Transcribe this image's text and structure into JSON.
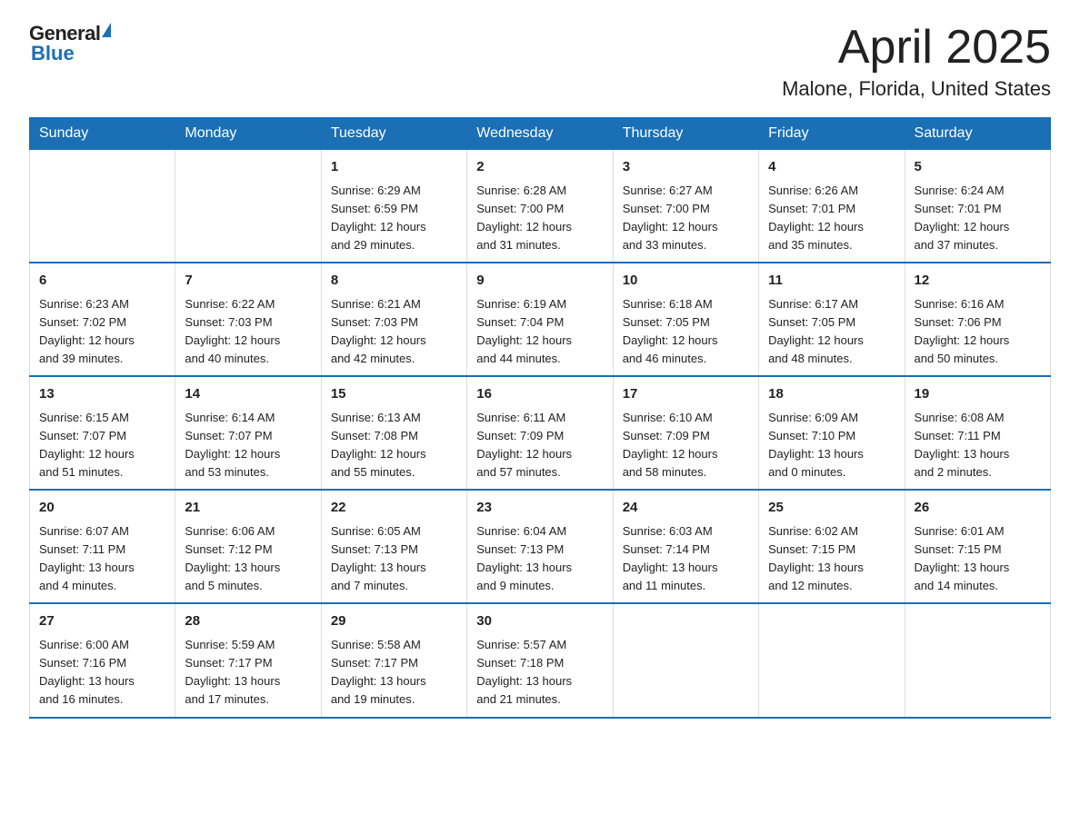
{
  "logo": {
    "text1": "General",
    "text2": "Blue"
  },
  "title": "April 2025",
  "subtitle": "Malone, Florida, United States",
  "days_of_week": [
    "Sunday",
    "Monday",
    "Tuesday",
    "Wednesday",
    "Thursday",
    "Friday",
    "Saturday"
  ],
  "weeks": [
    [
      {
        "day": "",
        "info": ""
      },
      {
        "day": "",
        "info": ""
      },
      {
        "day": "1",
        "info": "Sunrise: 6:29 AM\nSunset: 6:59 PM\nDaylight: 12 hours\nand 29 minutes."
      },
      {
        "day": "2",
        "info": "Sunrise: 6:28 AM\nSunset: 7:00 PM\nDaylight: 12 hours\nand 31 minutes."
      },
      {
        "day": "3",
        "info": "Sunrise: 6:27 AM\nSunset: 7:00 PM\nDaylight: 12 hours\nand 33 minutes."
      },
      {
        "day": "4",
        "info": "Sunrise: 6:26 AM\nSunset: 7:01 PM\nDaylight: 12 hours\nand 35 minutes."
      },
      {
        "day": "5",
        "info": "Sunrise: 6:24 AM\nSunset: 7:01 PM\nDaylight: 12 hours\nand 37 minutes."
      }
    ],
    [
      {
        "day": "6",
        "info": "Sunrise: 6:23 AM\nSunset: 7:02 PM\nDaylight: 12 hours\nand 39 minutes."
      },
      {
        "day": "7",
        "info": "Sunrise: 6:22 AM\nSunset: 7:03 PM\nDaylight: 12 hours\nand 40 minutes."
      },
      {
        "day": "8",
        "info": "Sunrise: 6:21 AM\nSunset: 7:03 PM\nDaylight: 12 hours\nand 42 minutes."
      },
      {
        "day": "9",
        "info": "Sunrise: 6:19 AM\nSunset: 7:04 PM\nDaylight: 12 hours\nand 44 minutes."
      },
      {
        "day": "10",
        "info": "Sunrise: 6:18 AM\nSunset: 7:05 PM\nDaylight: 12 hours\nand 46 minutes."
      },
      {
        "day": "11",
        "info": "Sunrise: 6:17 AM\nSunset: 7:05 PM\nDaylight: 12 hours\nand 48 minutes."
      },
      {
        "day": "12",
        "info": "Sunrise: 6:16 AM\nSunset: 7:06 PM\nDaylight: 12 hours\nand 50 minutes."
      }
    ],
    [
      {
        "day": "13",
        "info": "Sunrise: 6:15 AM\nSunset: 7:07 PM\nDaylight: 12 hours\nand 51 minutes."
      },
      {
        "day": "14",
        "info": "Sunrise: 6:14 AM\nSunset: 7:07 PM\nDaylight: 12 hours\nand 53 minutes."
      },
      {
        "day": "15",
        "info": "Sunrise: 6:13 AM\nSunset: 7:08 PM\nDaylight: 12 hours\nand 55 minutes."
      },
      {
        "day": "16",
        "info": "Sunrise: 6:11 AM\nSunset: 7:09 PM\nDaylight: 12 hours\nand 57 minutes."
      },
      {
        "day": "17",
        "info": "Sunrise: 6:10 AM\nSunset: 7:09 PM\nDaylight: 12 hours\nand 58 minutes."
      },
      {
        "day": "18",
        "info": "Sunrise: 6:09 AM\nSunset: 7:10 PM\nDaylight: 13 hours\nand 0 minutes."
      },
      {
        "day": "19",
        "info": "Sunrise: 6:08 AM\nSunset: 7:11 PM\nDaylight: 13 hours\nand 2 minutes."
      }
    ],
    [
      {
        "day": "20",
        "info": "Sunrise: 6:07 AM\nSunset: 7:11 PM\nDaylight: 13 hours\nand 4 minutes."
      },
      {
        "day": "21",
        "info": "Sunrise: 6:06 AM\nSunset: 7:12 PM\nDaylight: 13 hours\nand 5 minutes."
      },
      {
        "day": "22",
        "info": "Sunrise: 6:05 AM\nSunset: 7:13 PM\nDaylight: 13 hours\nand 7 minutes."
      },
      {
        "day": "23",
        "info": "Sunrise: 6:04 AM\nSunset: 7:13 PM\nDaylight: 13 hours\nand 9 minutes."
      },
      {
        "day": "24",
        "info": "Sunrise: 6:03 AM\nSunset: 7:14 PM\nDaylight: 13 hours\nand 11 minutes."
      },
      {
        "day": "25",
        "info": "Sunrise: 6:02 AM\nSunset: 7:15 PM\nDaylight: 13 hours\nand 12 minutes."
      },
      {
        "day": "26",
        "info": "Sunrise: 6:01 AM\nSunset: 7:15 PM\nDaylight: 13 hours\nand 14 minutes."
      }
    ],
    [
      {
        "day": "27",
        "info": "Sunrise: 6:00 AM\nSunset: 7:16 PM\nDaylight: 13 hours\nand 16 minutes."
      },
      {
        "day": "28",
        "info": "Sunrise: 5:59 AM\nSunset: 7:17 PM\nDaylight: 13 hours\nand 17 minutes."
      },
      {
        "day": "29",
        "info": "Sunrise: 5:58 AM\nSunset: 7:17 PM\nDaylight: 13 hours\nand 19 minutes."
      },
      {
        "day": "30",
        "info": "Sunrise: 5:57 AM\nSunset: 7:18 PM\nDaylight: 13 hours\nand 21 minutes."
      },
      {
        "day": "",
        "info": ""
      },
      {
        "day": "",
        "info": ""
      },
      {
        "day": "",
        "info": ""
      }
    ]
  ]
}
